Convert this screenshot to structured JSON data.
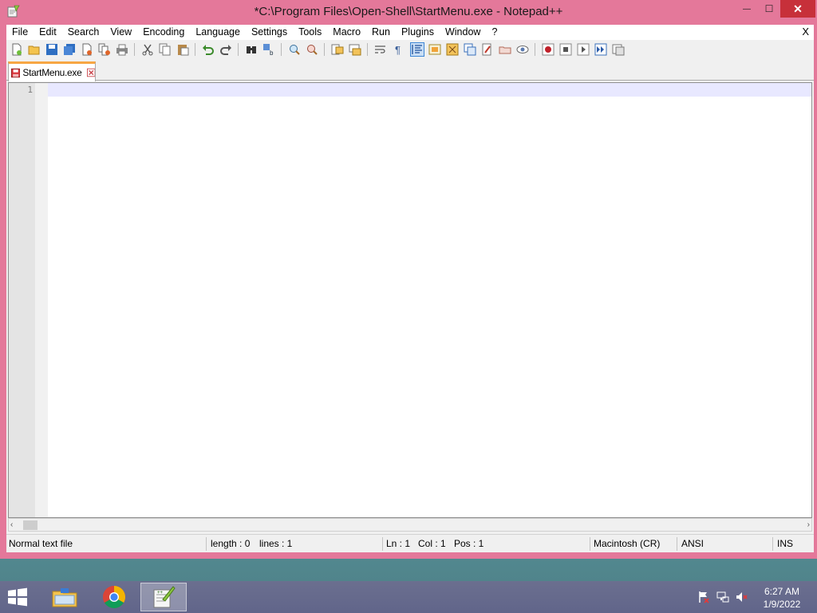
{
  "window": {
    "title": "*C:\\Program Files\\Open-Shell\\StartMenu.exe - Notepad++",
    "minimize_glyph": "—",
    "maximize_glyph": "☐",
    "close_glyph": "✕"
  },
  "menu": {
    "items": [
      "File",
      "Edit",
      "Search",
      "View",
      "Encoding",
      "Language",
      "Settings",
      "Tools",
      "Macro",
      "Run",
      "Plugins",
      "Window",
      "?"
    ],
    "close_label": "X"
  },
  "toolbar": {
    "buttons": [
      "new-file",
      "open-file",
      "save",
      "save-all",
      "close",
      "close-all",
      "print",
      "cut",
      "copy",
      "paste",
      "undo",
      "redo",
      "find",
      "replace",
      "zoom-in",
      "zoom-out",
      "sync-vertical",
      "sync-horizontal",
      "word-wrap",
      "show-all-chars",
      "indent-guide",
      "user-defined-language",
      "document-map",
      "function-list",
      "folder-as-workspace",
      "monitoring",
      "record-macro",
      "stop-recording",
      "playback-macro",
      "run-macro-multiple",
      "save-macro"
    ],
    "active_button": "indent-guide"
  },
  "tab": {
    "label": "StartMenu.exe",
    "accent_color": "#f7a643"
  },
  "editor": {
    "line_numbers": [
      "1"
    ],
    "current_line_color": "#e8e8ff"
  },
  "scrollbar": {
    "left_arrow": "‹",
    "right_arrow": "›"
  },
  "status": {
    "file_type": "Normal text file",
    "length": "length : 0",
    "lines": "lines : 1",
    "ln": "Ln : 1",
    "col": "Col : 1",
    "pos": "Pos : 1",
    "eol": "Macintosh (CR)",
    "encoding": "ANSI",
    "mode": "INS"
  },
  "taskbar": {
    "apps": [
      "file-explorer",
      "chrome",
      "notepad-plus-plus"
    ],
    "active_app": "notepad-plus-plus",
    "tray": [
      "action-center-flag",
      "network",
      "volume-muted"
    ],
    "time": "6:27 AM",
    "date": "1/9/2022"
  },
  "colors": {
    "window_frame": "#e4789a",
    "close_button": "#c7303a",
    "taskbar": "#64688b"
  }
}
